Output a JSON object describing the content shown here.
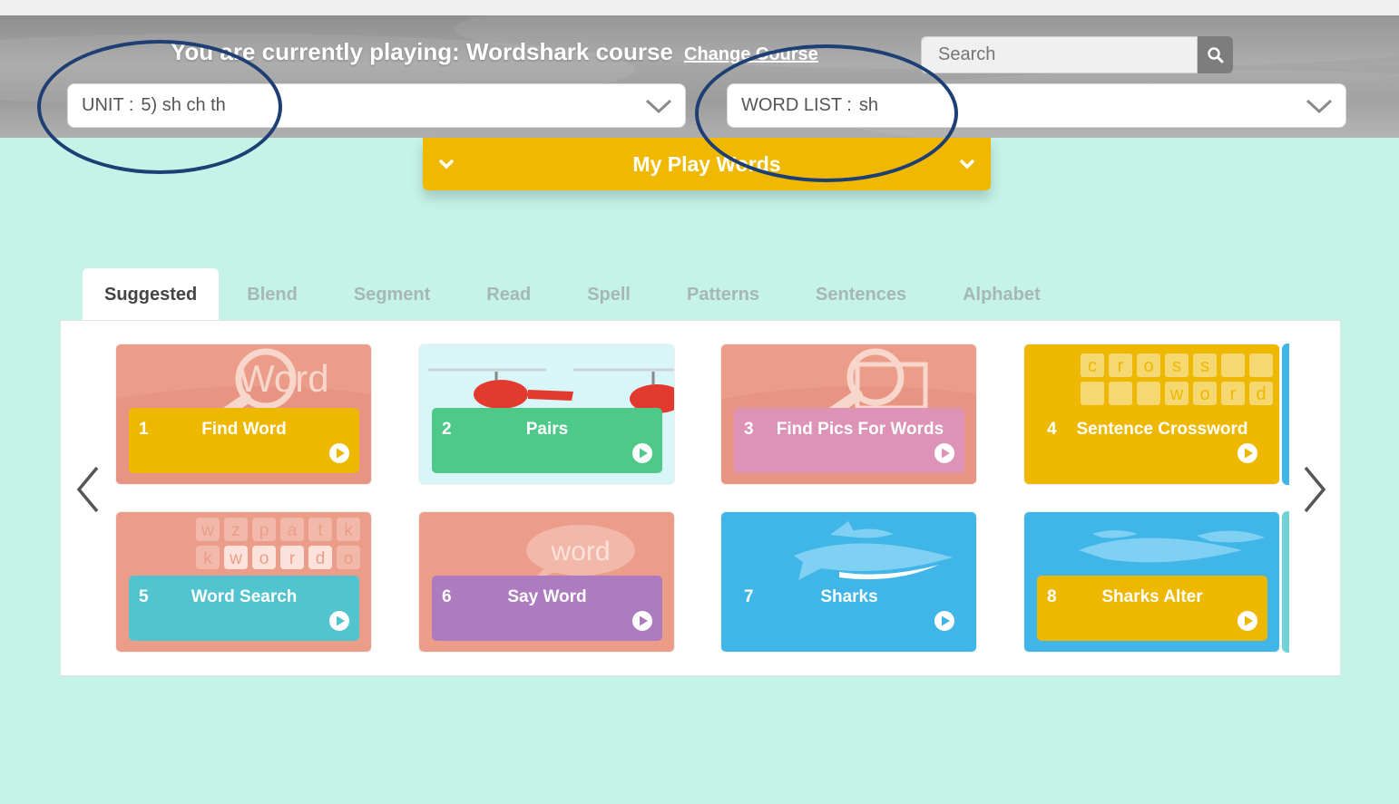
{
  "header": {
    "playing_text": "You are currently playing: Wordshark course",
    "change_course": "Change Course",
    "search": {
      "placeholder": "Search"
    },
    "unit_select": {
      "label": "UNIT :",
      "value": "5) sh ch th"
    },
    "wordlist_select": {
      "label": "WORD LIST :",
      "value": "sh"
    },
    "play_words": "My Play Words"
  },
  "tabs": [
    {
      "label": "Suggested",
      "active": true
    },
    {
      "label": "Blend",
      "active": false
    },
    {
      "label": "Segment",
      "active": false
    },
    {
      "label": "Read",
      "active": false
    },
    {
      "label": "Spell",
      "active": false
    },
    {
      "label": "Patterns",
      "active": false
    },
    {
      "label": "Sentences",
      "active": false
    },
    {
      "label": "Alphabet",
      "active": false
    }
  ],
  "games": [
    {
      "num": "1",
      "title": "Find Word",
      "label_color": "#eeb800",
      "bg_color": "#eb9d89"
    },
    {
      "num": "2",
      "title": "Pairs",
      "label_color": "#4fc98a",
      "bg_color": "#d8f5f8"
    },
    {
      "num": "3",
      "title": "Find Pics For Words",
      "label_color": "#dd93b6",
      "bg_color": "#eb9d89"
    },
    {
      "num": "4",
      "title": "Sentence Crossword",
      "label_color": "#eeb800",
      "bg_color": "#eeb800"
    },
    {
      "num": "5",
      "title": "Word Search",
      "label_color": "#52c4cf",
      "bg_color": "#eb9d89"
    },
    {
      "num": "6",
      "title": "Say Word",
      "label_color": "#ad7bbf",
      "bg_color": "#eb9d89"
    },
    {
      "num": "7",
      "title": "Sharks",
      "label_color": "#40b6e8",
      "bg_color": "#40b6e8"
    },
    {
      "num": "8",
      "title": "Sharks Alter",
      "label_color": "#eeb800",
      "bg_color": "#40b6e8"
    }
  ],
  "art_text": {
    "find_word": "Word",
    "crossword_top": [
      "c",
      "r",
      "o",
      "s",
      "s"
    ],
    "crossword_bottom": [
      "w",
      "o",
      "r",
      "d"
    ],
    "wordsearch_top": [
      "w",
      "z",
      "p",
      "a",
      "t",
      "k"
    ],
    "wordsearch_mid": [
      "k",
      "w",
      "o",
      "r",
      "d",
      "o"
    ],
    "say_word": "word"
  },
  "icons": {
    "search": "search-icon",
    "dropdown": "chevron-down-icon",
    "prev": "chevron-left-icon",
    "next": "chevron-right-icon",
    "play": "play-icon"
  }
}
